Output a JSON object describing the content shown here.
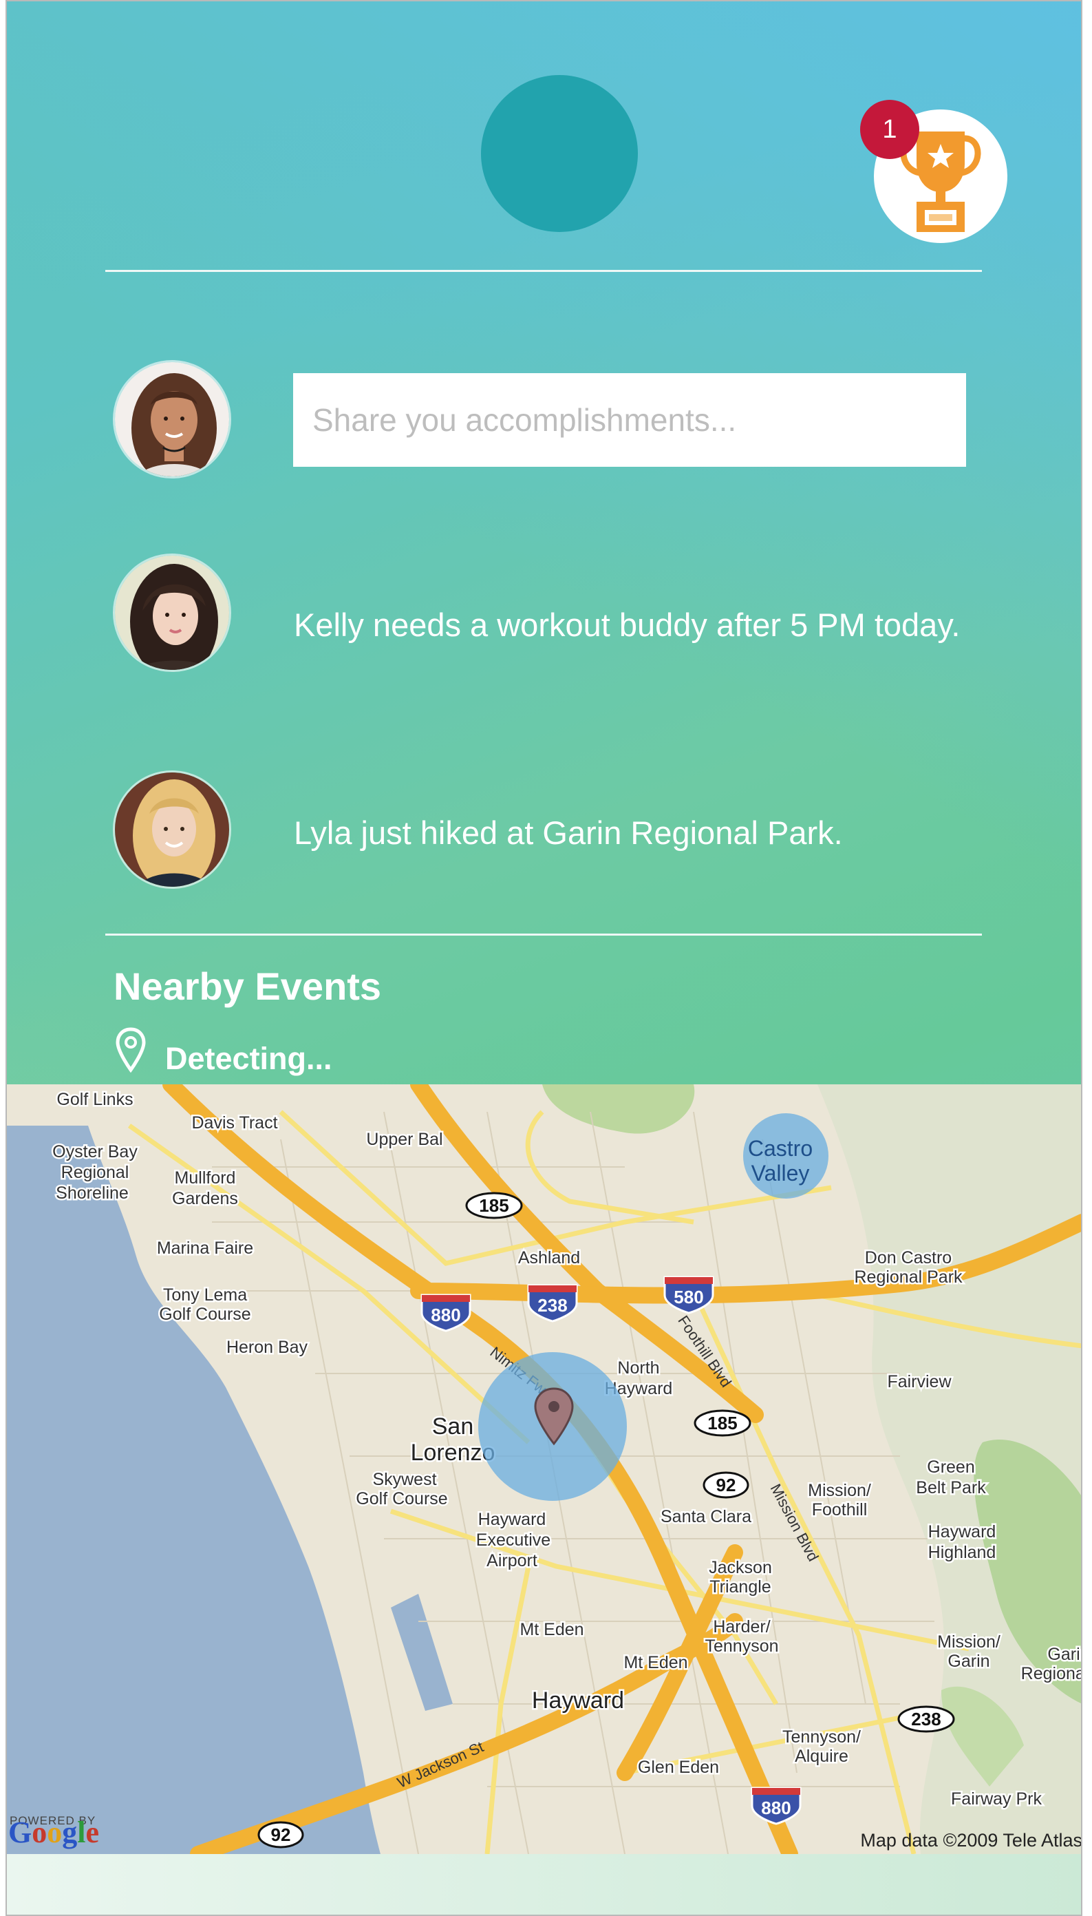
{
  "header": {
    "notification_count": "1"
  },
  "composer": {
    "placeholder": "Share you accomplishments..."
  },
  "feed": [
    {
      "text": "Kelly needs a workout buddy after 5 PM today."
    },
    {
      "text": "Lyla just hiked at Garin Regional Park."
    }
  ],
  "nearby": {
    "title": "Nearby Events",
    "status": "Detecting..."
  },
  "map": {
    "powered_by": "POWERED BY",
    "provider": "Google",
    "attribution": "Map data ©2009 Tele Atlas",
    "labels": {
      "davis_tract": "Davis Tract",
      "golf_links": "Golf Links",
      "oyster_bay_1": "Oyster Bay",
      "oyster_bay_2": "Regional",
      "oyster_bay_3": "Shoreline",
      "mullford_1": "Mullford",
      "mullford_2": "Gardens",
      "marina_faire": "Marina Faire",
      "tony_lema_1": "Tony Lema",
      "tony_lema_2": "Golf Course",
      "heron_bay": "Heron Bay",
      "upper_bal": "Upper Bal",
      "ashland": "Ashland",
      "castro_1": "Castro",
      "castro_2": "Valley",
      "don_castro_1": "Don Castro",
      "don_castro_2": "Regional Park",
      "fairview": "Fairview",
      "north_hayward_1": "North",
      "north_hayward_2": "Hayward",
      "san_lorenzo_1": "San",
      "san_lorenzo_2": "Lorenzo",
      "skywest_1": "Skywest",
      "skywest_2": "Golf Course",
      "hayward_exec_1": "Hayward",
      "hayward_exec_2": "Executive",
      "hayward_exec_3": "Airport",
      "santa_clara": "Santa Clara",
      "mission_foothill_1": "Mission/",
      "mission_foothill_2": "Foothill",
      "green_belt_1": "Green",
      "green_belt_2": "Belt Park",
      "hayward_highland_1": "Hayward",
      "hayward_highland_2": "Highland",
      "jackson_1": "Jackson",
      "jackson_2": "Triangle",
      "harder_1": "Harder/",
      "harder_2": "Tennyson",
      "mt_eden_1": "Mt Eden",
      "mt_eden_2": "Mt Eden",
      "mission_garin_1": "Mission/",
      "mission_garin_2": "Garin",
      "garin_1": "Garin",
      "garin_2": "Regional",
      "hayward": "Hayward",
      "tennyson_1": "Tennyson/",
      "tennyson_2": "Alquire",
      "glen_eden": "Glen Eden",
      "fairway_park": "Fairway Prk",
      "nimitz_fwy": "Nimitz Fwy",
      "foothill_blvd": "Foothill Blvd",
      "mission_blvd": "Mission Blvd",
      "w_jackson": "W Jackson St",
      "hwy_185a": "185",
      "hwy_185b": "185",
      "hwy_92a": "92",
      "hwy_92b": "92",
      "hwy_238a": "238",
      "hwy_238b": "238",
      "hwy_880a": "880",
      "hwy_880b": "880",
      "hwy_580": "580"
    }
  },
  "colors": {
    "accent": "#22a3ad",
    "badge": "#c4183a",
    "trophy": "#f29a2e",
    "freeway": "#f2b233",
    "water": "#99b3cf"
  },
  "icons": {
    "trophy": "trophy-icon",
    "pin": "location-pin-icon",
    "map_marker": "map-marker-icon"
  }
}
